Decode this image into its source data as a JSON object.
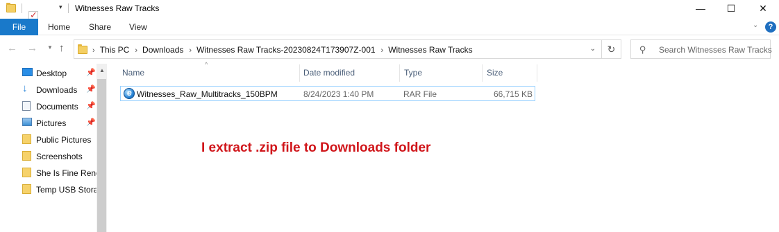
{
  "window": {
    "title": "Witnesses Raw Tracks",
    "minimize_glyph": "—",
    "maximize_glyph": "☐",
    "close_glyph": "✕"
  },
  "ribbon": {
    "tabs": [
      "File",
      "Home",
      "Share",
      "View"
    ],
    "file_color": "#1979ca",
    "help_glyph": "?"
  },
  "address": {
    "breadcrumbs": [
      "This PC",
      "Downloads",
      "Witnesses Raw Tracks-20230824T173907Z-001",
      "Witnesses Raw Tracks"
    ],
    "separator": "›"
  },
  "search": {
    "placeholder": "Search Witnesses Raw Tracks"
  },
  "nav_pane": {
    "items": [
      {
        "label": "Desktop",
        "icon": "desktop-icon",
        "pinned": true
      },
      {
        "label": "Downloads",
        "icon": "downloads-icon",
        "pinned": true
      },
      {
        "label": "Documents",
        "icon": "documents-icon",
        "pinned": true
      },
      {
        "label": "Pictures",
        "icon": "pictures-icon",
        "pinned": true
      },
      {
        "label": "Public Pictures",
        "icon": "folder-icon",
        "pinned": false
      },
      {
        "label": "Screenshots",
        "icon": "folder-icon",
        "pinned": false
      },
      {
        "label": "She Is Fine Rend",
        "icon": "folder-icon",
        "pinned": false
      },
      {
        "label": "Temp USB Storag",
        "icon": "folder-icon",
        "pinned": false
      }
    ]
  },
  "file_list": {
    "columns": [
      "Name",
      "Date modified",
      "Type",
      "Size"
    ],
    "rows": [
      {
        "name": "Witnesses_Raw_Multitracks_150BPM",
        "date_modified": "8/24/2023 1:40 PM",
        "type": "RAR File",
        "size": "66,715 KB",
        "icon": "rar-file-icon"
      }
    ]
  },
  "annotation": {
    "text": "I extract .zip file to Downloads folder",
    "color": "#d0161b"
  }
}
